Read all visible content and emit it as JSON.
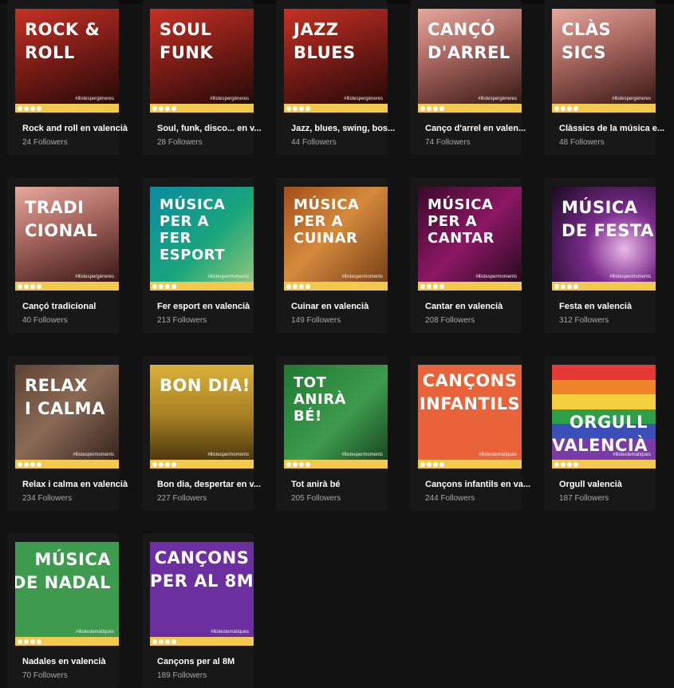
{
  "colors": {
    "background": "#121212",
    "card": "#181818",
    "subtitle": "#a7a7a7",
    "strip": "#f2c94c"
  },
  "playlists": [
    {
      "cover_text": "ROCK &\nROLL",
      "cover_tag": "#llistespergèneres",
      "title": "Rock and roll en valencià",
      "subtitle": "24 Followers",
      "cover_style": "red"
    },
    {
      "cover_text": "SOUL\nFUNK",
      "cover_tag": "#llistespergèneres",
      "title": "Soul, funk, disco... en v...",
      "subtitle": "28 Followers",
      "cover_style": "red"
    },
    {
      "cover_text": "JAZZ\nBLUES",
      "cover_tag": "#llistespergèneres",
      "title": "Jazz, blues, swing, bos...",
      "subtitle": "44 Followers",
      "cover_style": "red"
    },
    {
      "cover_text": "CANÇÓ\nD'ARREL",
      "cover_tag": "#llistespergèneres",
      "title": "Canço d'arrel en valen...",
      "subtitle": "74 Followers",
      "cover_style": "pink"
    },
    {
      "cover_text": "CLÀS\nSICS",
      "cover_tag": "#llistespergèneres",
      "title": "Clàssics de la música e...",
      "subtitle": "48 Followers",
      "cover_style": "pink"
    },
    {
      "cover_text": "TRADI\nCIONAL",
      "cover_tag": "#llistespergèneres",
      "title": "Cançó tradicional",
      "subtitle": "40 Followers",
      "cover_style": "pink"
    },
    {
      "cover_text": "MÚSICA\nPER A\nFER\nESPORT",
      "cover_tag": "#llistespermoments",
      "title": "Fer esport en valencià",
      "subtitle": "213 Followers",
      "cover_style": "blue"
    },
    {
      "cover_text": "MÚSICA\nPER A\nCUINAR",
      "cover_tag": "#llistespermoments",
      "title": "Cuinar en valencià",
      "subtitle": "149 Followers",
      "cover_style": "orange"
    },
    {
      "cover_text": "MÚSICA\nPER A\nCANTAR",
      "cover_tag": "#llistespermoments",
      "title": "Cantar en valencià",
      "subtitle": "208 Followers",
      "cover_style": "magenta"
    },
    {
      "cover_text": "MÚSICA\nDE FESTA",
      "cover_tag": "#llistespermoments",
      "title": "Festa en valencià",
      "subtitle": "312 Followers",
      "cover_style": "party"
    },
    {
      "cover_text": "RELAX\nI CALMA",
      "cover_tag": "#llistespermoments",
      "title": "Relax i calma en valencià",
      "subtitle": "234 Followers",
      "cover_style": "cat"
    },
    {
      "cover_text": "BON DIA!",
      "cover_tag": "#llistespermoments",
      "title": "Bon dia, despertar en v...",
      "subtitle": "227 Followers",
      "cover_style": "city"
    },
    {
      "cover_text": "TOT\nANIRÀ\nBÉ!",
      "cover_tag": "#llistespermoments",
      "title": "Tot anirà bé",
      "subtitle": "205 Followers",
      "cover_style": "green"
    },
    {
      "cover_text": "CANÇONS\nINFANTILS",
      "cover_tag": "#llistestemàtiques",
      "title": "Cançons infantils en va...",
      "subtitle": "244 Followers",
      "cover_style": "coral"
    },
    {
      "cover_text": "ORGULL\nVALENCIÀ",
      "cover_tag": "#llistestemàtiques",
      "title": "Orgull valencià",
      "subtitle": "187 Followers",
      "cover_style": "rainbow"
    },
    {
      "cover_text": "MÚSICA\nDE NADAL",
      "cover_tag": "#llistestemàtiques",
      "title": "Nadales en valencià",
      "subtitle": "70 Followers",
      "cover_style": "nadal"
    },
    {
      "cover_text": "CANÇONS\nPER AL 8M",
      "cover_tag": "#llistestemàtiques",
      "title": "Cançons per al 8M",
      "subtitle": "189 Followers",
      "cover_style": "purple"
    }
  ]
}
